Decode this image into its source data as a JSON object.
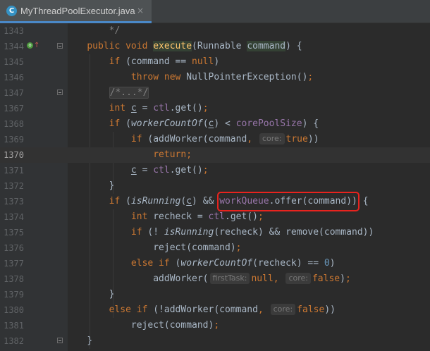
{
  "tab": {
    "icon_letter": "C",
    "title": "MyThreadPoolExecutor.java",
    "close_glyph": "×"
  },
  "gutter_icons": {
    "line_1344": [
      "implementation-marker-icon",
      "override-up-arrow-icon"
    ]
  },
  "colors": {
    "keyword": "#cc7832",
    "method_decl": "#ffc66d",
    "field": "#9876aa",
    "comment": "#808080",
    "number": "#6897bb",
    "default_text": "#a9b7c6",
    "highlight_box": "#e8231e"
  },
  "editor": {
    "lines": [
      {
        "num": "1343",
        "segments": [
          {
            "t": "        ",
            "c": ""
          },
          {
            "t": "*/",
            "c": "t-cm"
          }
        ]
      },
      {
        "num": "1344",
        "segments": [
          {
            "t": "    ",
            "c": ""
          },
          {
            "t": "public void ",
            "c": "t-kw"
          },
          {
            "t": "execute",
            "c": "t-fn-hl"
          },
          {
            "t": "(Runnable ",
            "c": ""
          },
          {
            "t": "command",
            "c": "t-par-hl"
          },
          {
            "t": ") {",
            "c": ""
          }
        ]
      },
      {
        "num": "1345",
        "segments": [
          {
            "t": "        ",
            "c": ""
          },
          {
            "t": "if ",
            "c": "t-kw"
          },
          {
            "t": "(command == ",
            "c": ""
          },
          {
            "t": "null",
            "c": "t-kw"
          },
          {
            "t": ")",
            "c": ""
          }
        ]
      },
      {
        "num": "1346",
        "segments": [
          {
            "t": "            ",
            "c": ""
          },
          {
            "t": "throw new ",
            "c": "t-kw"
          },
          {
            "t": "NullPointerException()",
            "c": ""
          },
          {
            "t": ";",
            "c": "t-kw"
          }
        ]
      },
      {
        "num": "1347",
        "segments": [
          {
            "t": "        ",
            "c": ""
          },
          {
            "t": "/*...*/",
            "c": "t-cm t-fold"
          }
        ]
      },
      {
        "num": "1367",
        "segments": [
          {
            "t": "        ",
            "c": ""
          },
          {
            "t": "int ",
            "c": "t-kw"
          },
          {
            "t": "c",
            "c": "t-und"
          },
          {
            "t": " = ",
            "c": ""
          },
          {
            "t": "ctl",
            "c": "t-field"
          },
          {
            "t": ".get()",
            "c": ""
          },
          {
            "t": ";",
            "c": "t-kw"
          }
        ]
      },
      {
        "num": "1368",
        "segments": [
          {
            "t": "        ",
            "c": ""
          },
          {
            "t": "if ",
            "c": "t-kw"
          },
          {
            "t": "(",
            "c": ""
          },
          {
            "t": "workerCountOf",
            "c": "t-italic"
          },
          {
            "t": "(",
            "c": ""
          },
          {
            "t": "c",
            "c": "t-und"
          },
          {
            "t": ") < ",
            "c": ""
          },
          {
            "t": "corePoolSize",
            "c": "t-field"
          },
          {
            "t": ") {",
            "c": ""
          }
        ]
      },
      {
        "num": "1369",
        "segments": [
          {
            "t": "            ",
            "c": ""
          },
          {
            "t": "if ",
            "c": "t-kw"
          },
          {
            "t": "(addWorker(command",
            "c": ""
          },
          {
            "t": ", ",
            "c": "t-kw"
          },
          {
            "t": "core:",
            "c": "t-hint"
          },
          {
            "t": "true",
            "c": "t-kw"
          },
          {
            "t": "))",
            "c": ""
          }
        ]
      },
      {
        "num": "1370",
        "segments": [
          {
            "t": "                ",
            "c": ""
          },
          {
            "t": "return;",
            "c": "t-kw"
          }
        ],
        "current": true
      },
      {
        "num": "1371",
        "segments": [
          {
            "t": "            ",
            "c": ""
          },
          {
            "t": "c",
            "c": "t-und"
          },
          {
            "t": " = ",
            "c": ""
          },
          {
            "t": "ctl",
            "c": "t-field"
          },
          {
            "t": ".get()",
            "c": ""
          },
          {
            "t": ";",
            "c": "t-kw"
          }
        ]
      },
      {
        "num": "1372",
        "segments": [
          {
            "t": "        ",
            "c": ""
          },
          {
            "t": "}",
            "c": ""
          }
        ]
      },
      {
        "num": "1373",
        "segments": [
          {
            "t": "        ",
            "c": ""
          },
          {
            "t": "if ",
            "c": "t-kw"
          },
          {
            "t": "(",
            "c": ""
          },
          {
            "t": "isRunning",
            "c": "t-italic"
          },
          {
            "t": "(",
            "c": ""
          },
          {
            "t": "c",
            "c": "t-und"
          },
          {
            "t": ") && ",
            "c": ""
          },
          {
            "t": "BOX",
            "c": "box"
          },
          {
            "t": " {",
            "c": ""
          }
        ]
      },
      {
        "num": "1374",
        "segments": [
          {
            "t": "            ",
            "c": ""
          },
          {
            "t": "int ",
            "c": "t-kw"
          },
          {
            "t": "recheck = ",
            "c": ""
          },
          {
            "t": "ctl",
            "c": "t-field"
          },
          {
            "t": ".get()",
            "c": ""
          },
          {
            "t": ";",
            "c": "t-kw"
          }
        ]
      },
      {
        "num": "1375",
        "segments": [
          {
            "t": "            ",
            "c": ""
          },
          {
            "t": "if ",
            "c": "t-kw"
          },
          {
            "t": "(! ",
            "c": ""
          },
          {
            "t": "isRunning",
            "c": "t-italic"
          },
          {
            "t": "(recheck) && remove(command))",
            "c": ""
          }
        ]
      },
      {
        "num": "1376",
        "segments": [
          {
            "t": "                ",
            "c": ""
          },
          {
            "t": "reject(command)",
            "c": ""
          },
          {
            "t": ";",
            "c": "t-kw"
          }
        ]
      },
      {
        "num": "1377",
        "segments": [
          {
            "t": "            ",
            "c": ""
          },
          {
            "t": "else if ",
            "c": "t-kw"
          },
          {
            "t": "(",
            "c": ""
          },
          {
            "t": "workerCountOf",
            "c": "t-italic"
          },
          {
            "t": "(recheck) == ",
            "c": ""
          },
          {
            "t": "0",
            "c": "t-num"
          },
          {
            "t": ")",
            "c": ""
          }
        ]
      },
      {
        "num": "1378",
        "segments": [
          {
            "t": "                ",
            "c": ""
          },
          {
            "t": "addWorker(",
            "c": ""
          },
          {
            "t": "firstTask:",
            "c": "t-hint"
          },
          {
            "t": "null",
            "c": "t-kw"
          },
          {
            "t": ", ",
            "c": "t-kw"
          },
          {
            "t": "core:",
            "c": "t-hint"
          },
          {
            "t": "false",
            "c": "t-kw"
          },
          {
            "t": ")",
            "c": ""
          },
          {
            "t": ";",
            "c": "t-kw"
          }
        ]
      },
      {
        "num": "1379",
        "segments": [
          {
            "t": "        ",
            "c": ""
          },
          {
            "t": "}",
            "c": ""
          }
        ]
      },
      {
        "num": "1380",
        "segments": [
          {
            "t": "        ",
            "c": ""
          },
          {
            "t": "else if ",
            "c": "t-kw"
          },
          {
            "t": "(!addWorker(command",
            "c": ""
          },
          {
            "t": ", ",
            "c": "t-kw"
          },
          {
            "t": "core:",
            "c": "t-hint"
          },
          {
            "t": "false",
            "c": "t-kw"
          },
          {
            "t": "))",
            "c": ""
          }
        ]
      },
      {
        "num": "1381",
        "segments": [
          {
            "t": "            ",
            "c": ""
          },
          {
            "t": "reject(command)",
            "c": ""
          },
          {
            "t": ";",
            "c": "t-kw"
          }
        ]
      },
      {
        "num": "1382",
        "segments": [
          {
            "t": "    ",
            "c": ""
          },
          {
            "t": "}",
            "c": ""
          }
        ]
      }
    ],
    "boxed_segments": [
      {
        "t": "workQueue",
        "c": "t-field"
      },
      {
        "t": ".offer(command))",
        "c": ""
      }
    ]
  }
}
